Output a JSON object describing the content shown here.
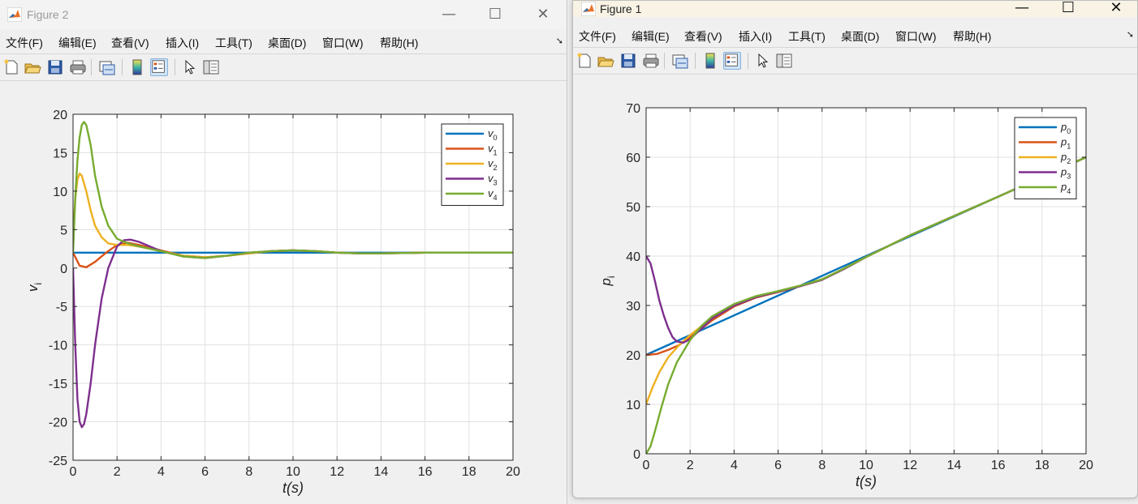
{
  "windows": {
    "figure2": {
      "title": "Figure 2",
      "menus": [
        "文件(F)",
        "编辑(E)",
        "查看(V)",
        "插入(I)",
        "工具(T)",
        "桌面(D)",
        "窗口(W)",
        "帮助(H)"
      ],
      "controls": {
        "minimize": "—",
        "maximize": "☐",
        "close": "✕"
      }
    },
    "figure1": {
      "title": "Figure 1",
      "menus": [
        "文件(F)",
        "编辑(E)",
        "查看(V)",
        "插入(I)",
        "工具(T)",
        "桌面(D)",
        "窗口(W)",
        "帮助(H)"
      ],
      "controls": {
        "minimize": "—",
        "maximize": "☐",
        "close": "✕"
      }
    }
  },
  "toolbar_icons": [
    "new-figure-icon",
    "open-file-icon",
    "save-icon",
    "print-icon",
    "link-plot-icon",
    "colorbar-icon",
    "legend-icon",
    "edit-plot-arrow-icon",
    "property-inspector-icon"
  ],
  "colors": {
    "s0": "#0072BD",
    "s1": "#D95319",
    "s2": "#EDB120",
    "s3": "#7E2F8E",
    "s4": "#77AC30"
  },
  "chart_data": [
    {
      "type": "line",
      "xlabel": "t(s)",
      "ylabel": "v_i",
      "xlim": [
        0,
        20
      ],
      "ylim": [
        -25,
        20
      ],
      "xticks": [
        "0",
        "2",
        "4",
        "6",
        "8",
        "10",
        "12",
        "14",
        "16",
        "18",
        "20"
      ],
      "yticks": [
        "-25",
        "-20",
        "-15",
        "-10",
        "-5",
        "0",
        "5",
        "10",
        "15",
        "20"
      ],
      "grid": true,
      "legend_position": "top-right",
      "series": [
        {
          "name": "v_0",
          "x": [
            0,
            20
          ],
          "y": [
            2,
            2
          ]
        },
        {
          "name": "v_1",
          "x": [
            0,
            0.3,
            0.6,
            1,
            1.5,
            2,
            2.5,
            3,
            4,
            5,
            6,
            7,
            8,
            9,
            10,
            11,
            12,
            13,
            14,
            16,
            18,
            20
          ],
          "y": [
            2,
            0.3,
            0.1,
            0.8,
            2.0,
            3.0,
            3.3,
            3.0,
            2.3,
            1.6,
            1.4,
            1.6,
            1.9,
            2.2,
            2.3,
            2.2,
            2.0,
            1.9,
            1.9,
            2.0,
            2.0,
            2.0
          ]
        },
        {
          "name": "v_2",
          "x": [
            0,
            0.1,
            0.2,
            0.3,
            0.4,
            0.6,
            0.8,
            1,
            1.3,
            1.6,
            2,
            2.5,
            3,
            4,
            5,
            6,
            7,
            8,
            9,
            10,
            11,
            12,
            13,
            14,
            16,
            18,
            20
          ],
          "y": [
            4,
            9,
            11.5,
            12.3,
            12.0,
            10,
            7.5,
            5.5,
            4.0,
            3.2,
            3.0,
            3.0,
            2.8,
            2.2,
            1.6,
            1.4,
            1.6,
            1.9,
            2.2,
            2.3,
            2.2,
            2.0,
            1.9,
            1.9,
            2.0,
            2.0,
            2.0
          ]
        },
        {
          "name": "v_3",
          "x": [
            0,
            0.1,
            0.2,
            0.3,
            0.4,
            0.5,
            0.6,
            0.8,
            1,
            1.3,
            1.6,
            2,
            2.3,
            2.6,
            3,
            3.5,
            4,
            5,
            6,
            7,
            8,
            9,
            10,
            11,
            12,
            13,
            14,
            16,
            18,
            20
          ],
          "y": [
            0,
            -10,
            -17,
            -20,
            -20.7,
            -20.3,
            -19,
            -15,
            -10,
            -4,
            0,
            2.8,
            3.6,
            3.7,
            3.4,
            2.8,
            2.2,
            1.5,
            1.3,
            1.6,
            2.0,
            2.2,
            2.3,
            2.2,
            2.0,
            1.9,
            1.9,
            2.0,
            2.0,
            2.0
          ]
        },
        {
          "name": "v_4",
          "x": [
            0,
            0.1,
            0.2,
            0.3,
            0.4,
            0.5,
            0.6,
            0.8,
            1,
            1.3,
            1.6,
            2,
            2.5,
            3,
            4,
            5,
            6,
            7,
            8,
            9,
            10,
            11,
            12,
            13,
            14,
            16,
            18,
            20
          ],
          "y": [
            2,
            9,
            14,
            17,
            18.6,
            19,
            18.6,
            16,
            12,
            8,
            5.5,
            3.8,
            3.2,
            2.8,
            2.2,
            1.5,
            1.3,
            1.6,
            2.0,
            2.2,
            2.3,
            2.2,
            2.0,
            1.9,
            1.9,
            2.0,
            2.0,
            2.0
          ]
        }
      ]
    },
    {
      "type": "line",
      "xlabel": "t(s)",
      "ylabel": "p_i",
      "xlim": [
        0,
        20
      ],
      "ylim": [
        0,
        70
      ],
      "xticks": [
        "0",
        "2",
        "4",
        "6",
        "8",
        "10",
        "12",
        "14",
        "16",
        "18",
        "20"
      ],
      "yticks": [
        "0",
        "10",
        "20",
        "30",
        "40",
        "50",
        "60",
        "70"
      ],
      "grid": true,
      "legend_position": "top-right",
      "series": [
        {
          "name": "p_0",
          "x": [
            0,
            20
          ],
          "y": [
            20,
            60
          ]
        },
        {
          "name": "p_1",
          "x": [
            0,
            0.5,
            1,
            1.5,
            2,
            3,
            4,
            5,
            6,
            7,
            8,
            9,
            10,
            12,
            14,
            16,
            18,
            20
          ],
          "y": [
            20,
            20.2,
            21,
            22,
            23.5,
            27,
            29.8,
            31.6,
            32.7,
            33.9,
            35.2,
            37.4,
            39.8,
            44.2,
            48.1,
            52.0,
            56.0,
            60.0
          ]
        },
        {
          "name": "p_2",
          "x": [
            0,
            0.3,
            0.6,
            1,
            1.5,
            2,
            3,
            4,
            5,
            6,
            7,
            8,
            9,
            10,
            12,
            14,
            16,
            18,
            20
          ],
          "y": [
            10,
            13.5,
            16.5,
            19.5,
            22,
            24,
            27.5,
            30.1,
            31.8,
            32.9,
            34,
            35.3,
            37.5,
            39.8,
            44.2,
            48.1,
            52.0,
            56.0,
            60.0
          ]
        },
        {
          "name": "p_3",
          "x": [
            0,
            0.2,
            0.4,
            0.6,
            0.8,
            1,
            1.2,
            1.4,
            1.7,
            2,
            2.5,
            3,
            4,
            5,
            6,
            7,
            8,
            9,
            10,
            12,
            14,
            16,
            18,
            20
          ],
          "y": [
            40,
            38.5,
            35,
            31,
            28,
            25.5,
            23.6,
            22.7,
            22.5,
            23.2,
            25.3,
            27.4,
            30.0,
            31.7,
            32.8,
            33.9,
            35.2,
            37.4,
            39.8,
            44.2,
            48.1,
            52.0,
            56.0,
            60.0
          ]
        },
        {
          "name": "p_4",
          "x": [
            0,
            0.2,
            0.4,
            0.7,
            1,
            1.4,
            2,
            2.5,
            3,
            4,
            5,
            6,
            7,
            8,
            9,
            10,
            12,
            14,
            16,
            18,
            20
          ],
          "y": [
            0,
            1.5,
            4.5,
            9.5,
            14,
            18.5,
            23,
            25.8,
            27.8,
            30.3,
            31.9,
            32.9,
            34,
            35.3,
            37.5,
            39.8,
            44.2,
            48.1,
            52.0,
            56.0,
            60.0
          ]
        }
      ]
    }
  ]
}
